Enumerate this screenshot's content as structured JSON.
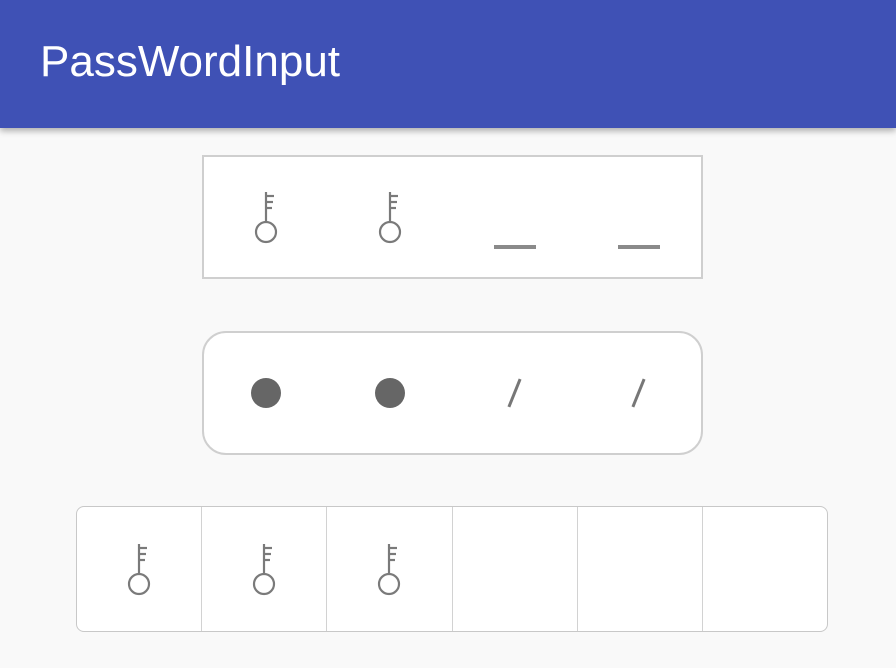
{
  "app_bar": {
    "title": "PassWordInput"
  },
  "inputs": [
    {
      "style": "square-border",
      "cells": [
        "key-icon",
        "key-icon",
        "underline",
        "underline"
      ],
      "filled_count": 2,
      "length": 4
    },
    {
      "style": "rounded-border",
      "cells": [
        "filled-dot",
        "filled-dot",
        "slash",
        "slash"
      ],
      "filled_count": 2,
      "length": 4
    },
    {
      "style": "grid-cells",
      "cells": [
        "key-icon",
        "key-icon",
        "key-icon",
        "empty",
        "empty",
        "empty"
      ],
      "filled_count": 3,
      "length": 6
    }
  ],
  "colors": {
    "app_bar": "#3f51b5",
    "background": "#f9f9f9",
    "icon": "#777777",
    "dot": "#666666",
    "border": "#cfcfcf"
  }
}
